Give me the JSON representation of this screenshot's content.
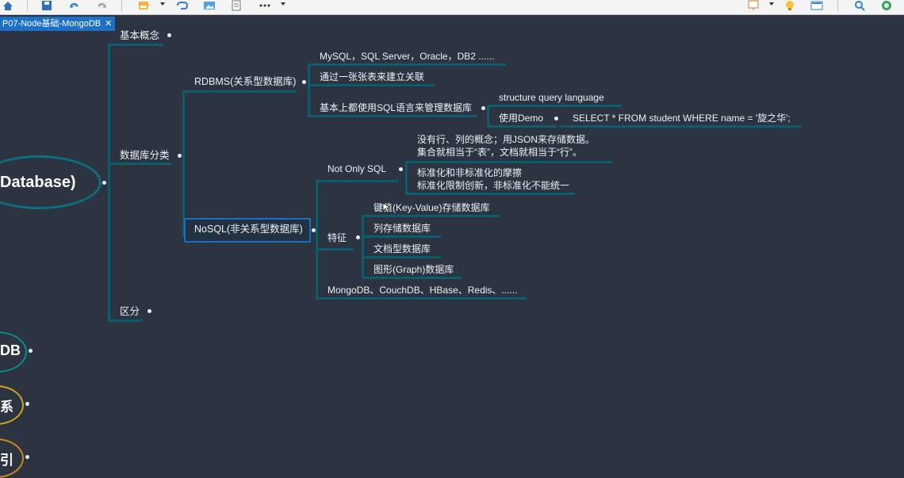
{
  "tab": {
    "title": "P07-Node基础-MongoDB",
    "close": "✕"
  },
  "toolbar": {
    "icons": [
      "home-icon",
      "save-icon",
      "undo-icon",
      "redo-icon",
      "style-icon",
      "link-icon",
      "image-icon",
      "notes-icon",
      "more-icon",
      "present-icon",
      "idea-icon",
      "outline-icon",
      "search-icon",
      "share-icon"
    ]
  },
  "map": {
    "root": "Database)",
    "siblings": [
      "DB",
      "系",
      "引"
    ],
    "branches": {
      "basic": "基本概念",
      "categories": "数据库分类",
      "diff": "区分"
    },
    "rdbms": {
      "label": "RDBMS(关系型数据库)",
      "examples": "MySQL，SQL Server，Oracle，DB2 ......",
      "relation": "通过一张张表来建立关联",
      "sql": "基本上都使用SQL语言来管理数据库",
      "sql_full": "structure query language",
      "demo_label": "使用Demo",
      "demo_sql": "SELECT * FROM student WHERE name = '旋之华';"
    },
    "nosql": {
      "label": "NoSQL(非关系型数据库)",
      "not_only": "Not Only SQL",
      "concept_line1": "没有行、列的概念；用JSON来存储数据。",
      "concept_line2": "集合就相当于“表”，文档就相当于“行”。",
      "std_line1": "标准化和非标准化的摩擦",
      "std_line2": "标准化限制创新，非标准化不能统一",
      "features": "特征",
      "feature_items": [
        "键值(Key-Value)存储数据库",
        "列存储数据库",
        "文档型数据库",
        "图形(Graph)数据库"
      ],
      "products": "MongoDB、CouchDB、HBase、Redis、......"
    }
  }
}
